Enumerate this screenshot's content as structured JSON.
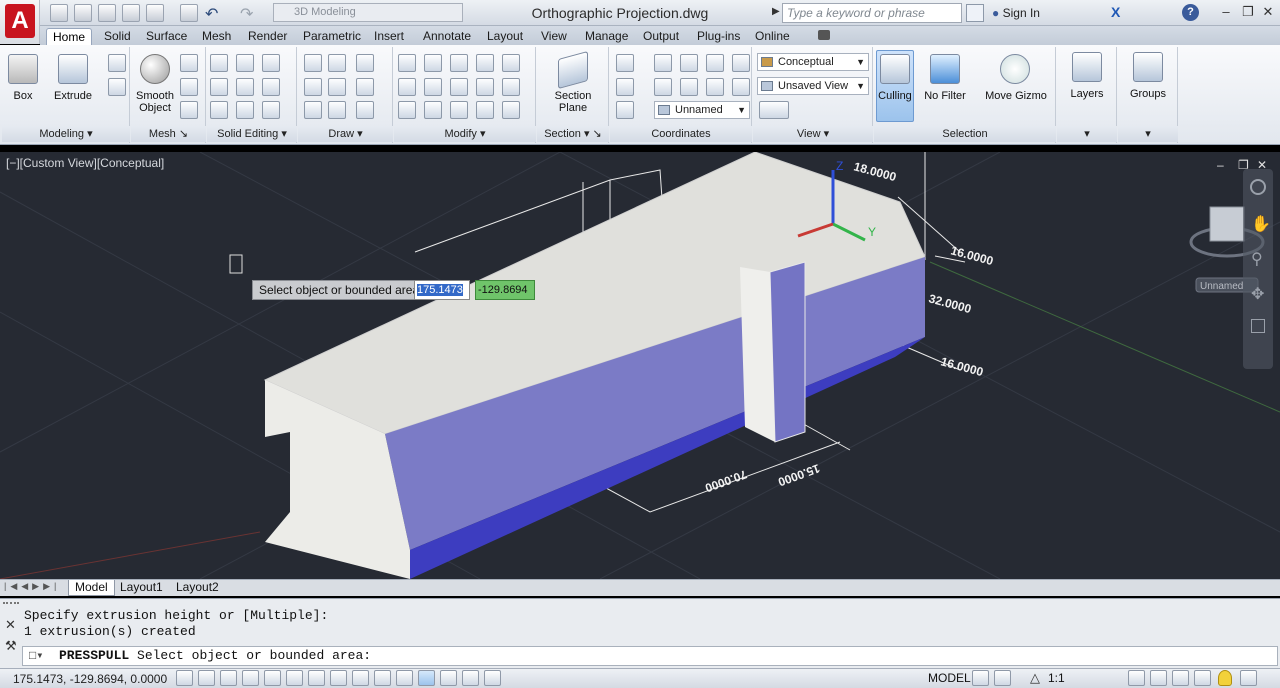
{
  "title_bar": {
    "workspace": "3D Modeling",
    "doc_title": "Orthographic Projection.dwg",
    "search_placeholder": "Type a keyword or phrase",
    "signin": "Sign In"
  },
  "tabs": [
    "Home",
    "Solid",
    "Surface",
    "Mesh",
    "Render",
    "Parametric",
    "Insert",
    "Annotate",
    "Layout",
    "View",
    "Manage",
    "Output",
    "Plug-ins",
    "Online"
  ],
  "ribbon": {
    "modeling": {
      "box": "Box",
      "extrude": "Extrude",
      "title": "Modeling"
    },
    "mesh": {
      "smooth": "Smooth",
      "object": "Object",
      "title": "Mesh"
    },
    "solid_editing": {
      "title": "Solid Editing"
    },
    "draw": {
      "title": "Draw"
    },
    "modify": {
      "title": "Modify"
    },
    "section": {
      "label1": "Section",
      "label2": "Plane",
      "title": "Section"
    },
    "coordinates": {
      "ucs_name": "Unnamed",
      "title": "Coordinates"
    },
    "view": {
      "visual_style": "Conceptual",
      "saved_view": "Unsaved View",
      "title": "View"
    },
    "selection": {
      "culling": "Culling",
      "no_filter": "No Filter",
      "move_gizmo": "Move Gizmo",
      "title": "Selection"
    },
    "layers": {
      "label": "Layers"
    },
    "groups": {
      "label": "Groups"
    }
  },
  "viewport": {
    "label": "[−][Custom View][Conceptual]",
    "dim_18": "18.0000",
    "dim_16a": "16.0000",
    "dim_32": "32.0000",
    "dim_16b": "16.0000",
    "dim_bottom1": "70.0000",
    "dim_bottom2": "15.0000",
    "axis_z": "Z",
    "axis_y": "Y",
    "cube_name": "Unnamed",
    "tooltip_prompt": "Select object or bounded area:",
    "input1": "175.1473",
    "input2": "-129.8694"
  },
  "layout_tabs": [
    "Model",
    "Layout1",
    "Layout2"
  ],
  "command": {
    "history1": "Specify extrusion height or [Multiple]:",
    "history2": "1 extrusion(s) created",
    "cmd_name": "PRESSPULL",
    "prompt": "Select object or bounded area:"
  },
  "status": {
    "coords": "175.1473, -129.8694, 0.0000",
    "model": "MODEL",
    "scale": "1:1"
  },
  "colors": {
    "viewport_bg": "#262a33",
    "solid_top": "#dcdcd8",
    "solid_side": "#7474c4",
    "accent_red": "#c8141e"
  }
}
